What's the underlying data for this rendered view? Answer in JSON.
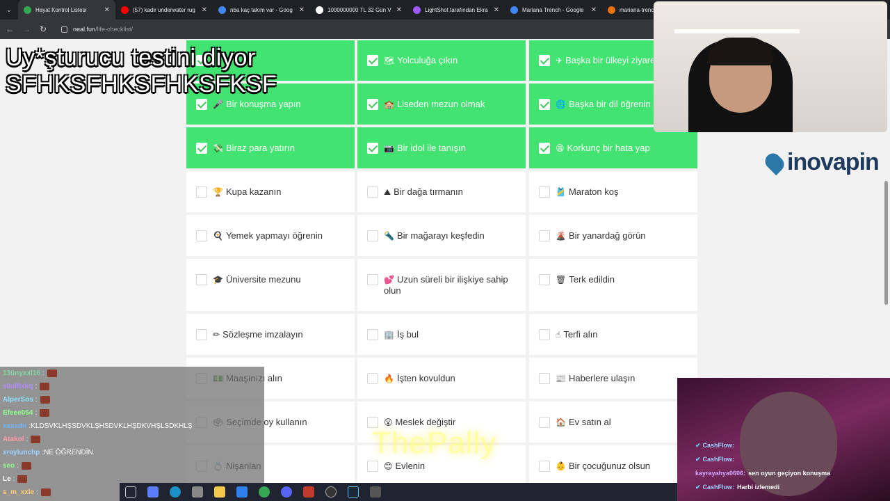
{
  "browser": {
    "tabs": [
      {
        "title": "Hayat Kontrol Listesi",
        "color": "#34a853",
        "active": true
      },
      {
        "title": "(57) kadir underwater rug",
        "color": "#ff0000"
      },
      {
        "title": "nba kaç takım var - Goog",
        "color": "#4285f4"
      },
      {
        "title": "1000000000 TL 32 Gün V",
        "color": "#ffffff"
      },
      {
        "title": "LightShot tarafından Ekra",
        "color": "#9b59ff"
      },
      {
        "title": "Mariana Trench - Google",
        "color": "#4285f4"
      },
      {
        "title": "mariana-trench-s",
        "color": "#e8710a"
      }
    ],
    "url_host": "neal.fun",
    "url_path": "/life-checklist/"
  },
  "caption": {
    "line1": "Uy*şturucu testini diyor",
    "line2": "SFHKSFHKSFHKSFKSF"
  },
  "checklist": [
    {
      "label": "",
      "emoji": "",
      "done": true
    },
    {
      "label": "Yolculuğa çıkın",
      "emoji": "🗺",
      "done": true
    },
    {
      "label": "Başka bir ülkeyi ziyaret",
      "emoji": "✈",
      "done": true
    },
    {
      "label": "Bir konuşma yapın",
      "emoji": "🎤",
      "done": true
    },
    {
      "label": "Liseden mezun olmak",
      "emoji": "🏫",
      "done": true
    },
    {
      "label": "Başka bir dil öğrenin",
      "emoji": "🌐",
      "done": true
    },
    {
      "label": "Biraz para yatırın",
      "emoji": "💸",
      "done": true
    },
    {
      "label": "Bir idol ile tanışın",
      "emoji": "📷",
      "done": true
    },
    {
      "label": "Korkunç bir hata yap",
      "emoji": "😫",
      "done": true
    },
    {
      "label": "Kupa kazanın",
      "emoji": "🏆",
      "done": false
    },
    {
      "label": "Bir dağa tırmanın",
      "emoji": "⛰",
      "done": false
    },
    {
      "label": "Maraton koş",
      "emoji": "🎽",
      "done": false
    },
    {
      "label": "Yemek yapmayı öğrenin",
      "emoji": "🍳",
      "done": false
    },
    {
      "label": "Bir mağarayı keşfedin",
      "emoji": "🔦",
      "done": false
    },
    {
      "label": "Bir yanardağ görün",
      "emoji": "🌋",
      "done": false
    },
    {
      "label": "Üniversite mezunu",
      "emoji": "🎓",
      "done": false
    },
    {
      "label": "Uzun süreli bir ilişkiye sahip olun",
      "emoji": "💕",
      "done": false
    },
    {
      "label": "Terk edildin",
      "emoji": "🗑",
      "done": false
    },
    {
      "label": "Sözleşme imzalayın",
      "emoji": "✏",
      "done": false
    },
    {
      "label": "İş bul",
      "emoji": "🏢",
      "done": false
    },
    {
      "label": "Terfi alın",
      "emoji": "☝",
      "done": false
    },
    {
      "label": "Maaşınızı alın",
      "emoji": "💵",
      "done": false
    },
    {
      "label": "İşten kovuldun",
      "emoji": "🔥",
      "done": false
    },
    {
      "label": "Haberlere ulaşın",
      "emoji": "📰",
      "done": false
    },
    {
      "label": "Seçimde oy kullanın",
      "emoji": "🗳",
      "done": false
    },
    {
      "label": "Meslek değiştir",
      "emoji": "😮",
      "done": false
    },
    {
      "label": "Ev satın al",
      "emoji": "🏠",
      "done": false
    },
    {
      "label": "Nişanlan",
      "emoji": "💍",
      "done": false
    },
    {
      "label": "Evlenin",
      "emoji": "😊",
      "done": false
    },
    {
      "label": "Bir çocuğunuz olsun",
      "emoji": "👶",
      "done": false
    }
  ],
  "logo": {
    "text": "inovapin"
  },
  "chat_left": [
    {
      "user": "13ünyxxl16",
      "text": "",
      "color": "#7fd6a6"
    },
    {
      "user": "s0ulfixkq",
      "text": "",
      "color": "#b48cff"
    },
    {
      "user": "AlperSos",
      "text": "",
      "color": "#8fe3ff"
    },
    {
      "user": "Efeee054",
      "text": "",
      "color": "#8cff8c"
    },
    {
      "user": "xsxxdn",
      "text": "KLDSVKLHŞSDVKLŞHSDVKLHŞDKVHŞLSDKHLŞ",
      "color": "#6fb6ff"
    },
    {
      "user": "Atakol",
      "text": "",
      "color": "#ff9aa8"
    },
    {
      "user": "xraylunchp",
      "text": "NE ÖĞRENDİN",
      "color": "#9fd0ff"
    },
    {
      "user": "seo",
      "text": "",
      "color": "#8cff8c"
    },
    {
      "user": "Le",
      "text": "",
      "color": "#ffffff"
    },
    {
      "user": "s_m_xxle",
      "text": "",
      "color": "#ffcf6f"
    }
  ],
  "chat_right": [
    {
      "user": "CashFlow:",
      "text": "",
      "pink": false
    },
    {
      "user": "CashFlow:",
      "text": "",
      "pink": false
    },
    {
      "user": "kayrayahya0606:",
      "text": "sen oyun geçiyon konuşma",
      "pink": true
    },
    {
      "user": "CashFlow:",
      "text": "Harbi izlemedi",
      "pink": false
    }
  ],
  "watermark": "ThePally"
}
